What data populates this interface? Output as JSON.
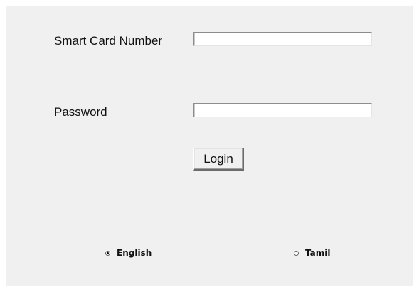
{
  "form": {
    "card_label": "Smart Card Number",
    "card_value": "",
    "password_label": "Password",
    "password_value": "",
    "login_label": "Login"
  },
  "language": {
    "english_label": "English",
    "tamil_label": "Tamil",
    "selected": "English"
  }
}
